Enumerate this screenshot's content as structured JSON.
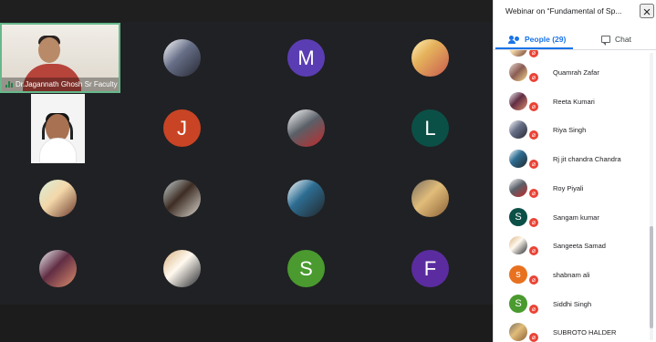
{
  "app": {
    "panel_title": "Webinar on “Fundamental of Sp...",
    "close_icon": "close-icon"
  },
  "meeting": {
    "speaker_name": "Dr.Jagannath Ghosh Sr Faculty"
  },
  "grid": {
    "tiles": [
      {
        "type": "photo",
        "style": "photo-b"
      },
      {
        "type": "initial",
        "initial": "M",
        "color": "#5b3db3"
      },
      {
        "type": "photo",
        "style": "photo-c"
      },
      {
        "type": "initial",
        "initial": "J",
        "color": "#c94424"
      },
      {
        "type": "photo",
        "style": "photo-d"
      },
      {
        "type": "initial",
        "initial": "L",
        "color": "#0b5047"
      },
      {
        "type": "photo",
        "style": "photo-e"
      },
      {
        "type": "photo",
        "style": "photo-f"
      },
      {
        "type": "photo",
        "style": "photo-g"
      },
      {
        "type": "photo",
        "style": "photo-h"
      },
      {
        "type": "photo",
        "style": "photo-i"
      },
      {
        "type": "photo",
        "style": "photo-j"
      },
      {
        "type": "initial",
        "initial": "S",
        "color": "#4a9a2f"
      },
      {
        "type": "initial",
        "initial": "F",
        "color": "#5b2c9f"
      }
    ]
  },
  "tabs": {
    "people_label": "People (29)",
    "chat_label": "Chat",
    "people_icon": "people-icon",
    "chat_icon": "chat-icon"
  },
  "people": {
    "items": [
      {
        "name": "Quamrah Zafar",
        "avatar": "photo-a",
        "initial": "",
        "color": ""
      },
      {
        "name": "Reeta Kumari",
        "avatar": "photo-i",
        "initial": "",
        "color": ""
      },
      {
        "name": "Riya Singh",
        "avatar": "photo-b",
        "initial": "",
        "color": ""
      },
      {
        "name": "Rj jit chandra Chandra",
        "avatar": "photo-g",
        "initial": "",
        "color": ""
      },
      {
        "name": "Roy Piyali",
        "avatar": "photo-d",
        "initial": "",
        "color": ""
      },
      {
        "name": "Sangam kumar",
        "avatar": "",
        "initial": "S",
        "color": "#0b5047"
      },
      {
        "name": "Sangeeta Samad",
        "avatar": "photo-j",
        "initial": "",
        "color": ""
      },
      {
        "name": "shabnam ali",
        "avatar": "",
        "initial": "s",
        "color": "#e8711f"
      },
      {
        "name": "Siddhi Singh",
        "avatar": "",
        "initial": "S",
        "color": "#4a9a2f"
      },
      {
        "name": "SUBROTO HALDER",
        "avatar": "photo-h",
        "initial": "",
        "color": ""
      }
    ]
  }
}
